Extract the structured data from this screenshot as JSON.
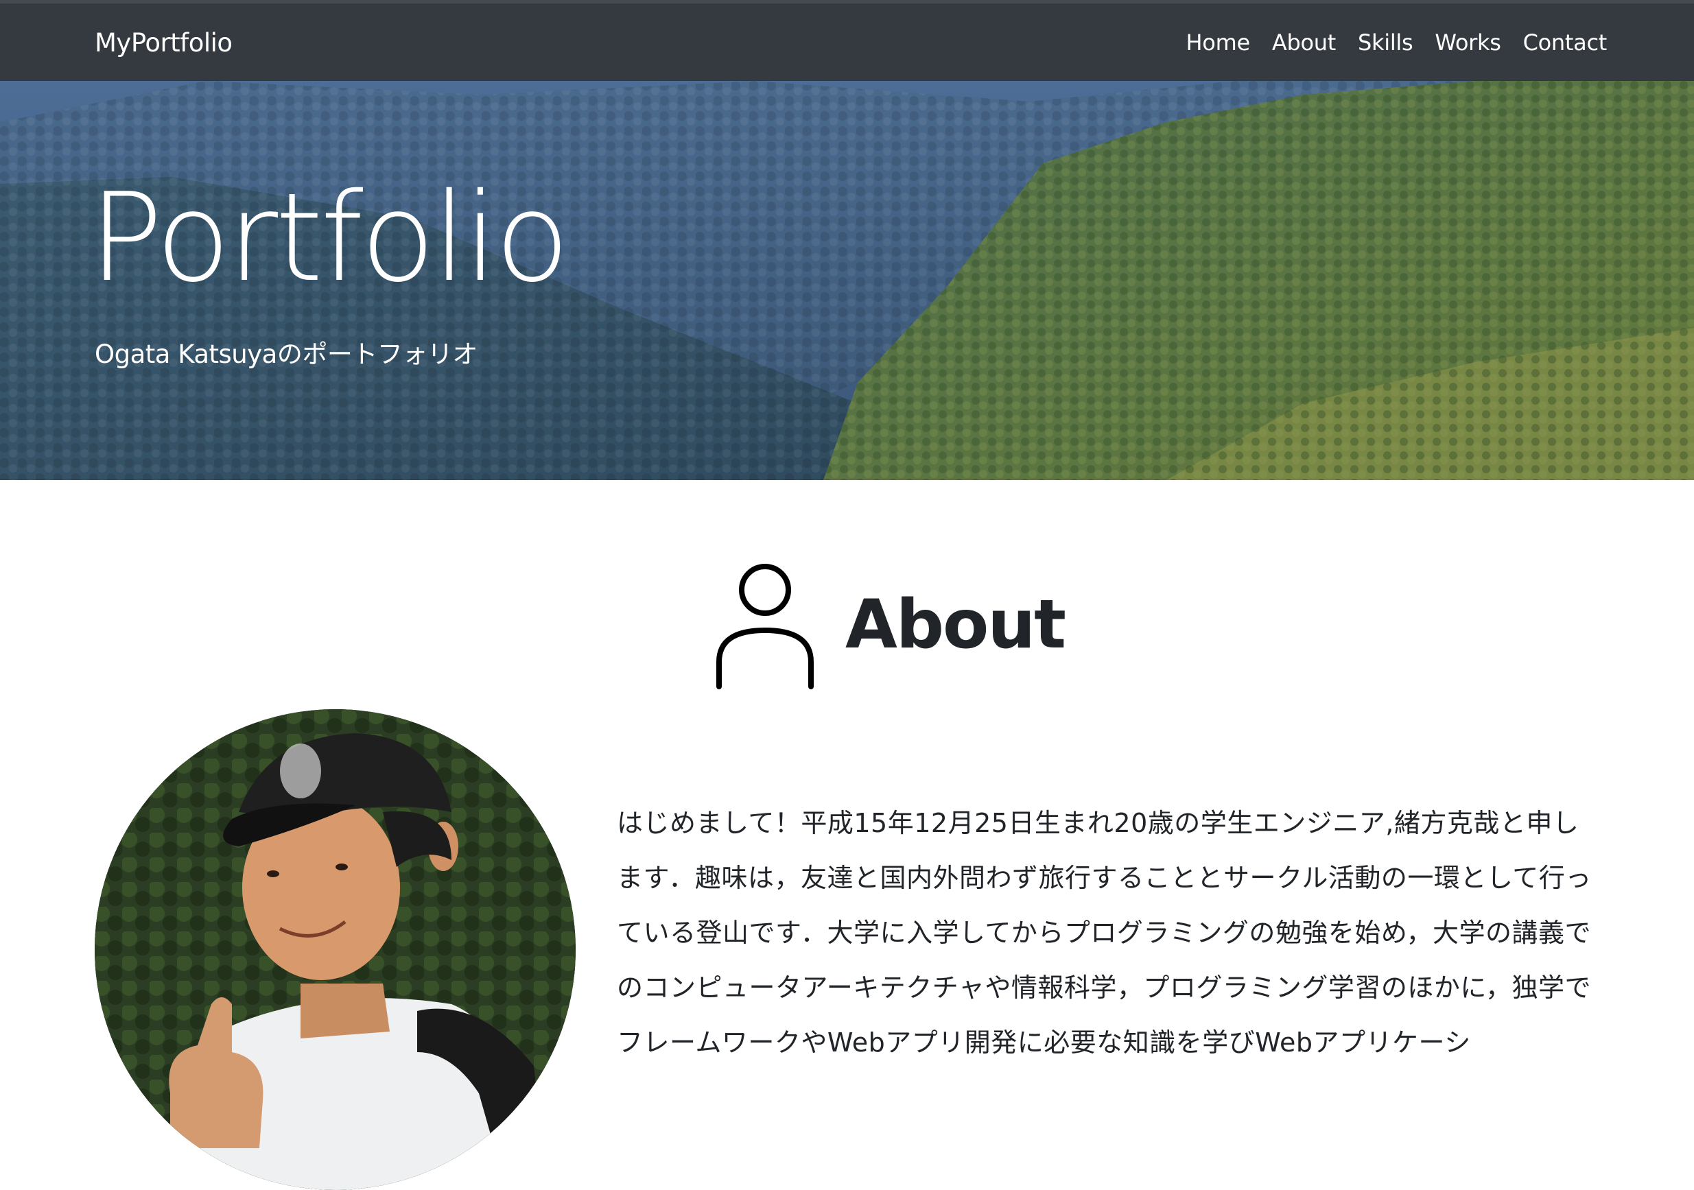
{
  "navbar": {
    "brand": "MyPortfolio",
    "links": [
      "Home",
      "About",
      "Skills",
      "Works",
      "Contact"
    ]
  },
  "hero": {
    "title": "Portfolio",
    "subtitle": "Ogata Katsuyaのポートフォリオ"
  },
  "about": {
    "icon": "person-icon",
    "title": "About",
    "text": "はじめまして！平成15年12月25日生まれ20歳の学生エンジニア,緒方克哉と申します．趣味は，友達と国内外問わず旅行することとサークル活動の一環として行っている登山です．大学に入学してからプログラミングの勉強を始め，大学の講義でのコンピュータアーキテクチャや情報科学，プログラミング学習のほかに，独学でフレームワークやWebアプリ開発に必要な知識を学びWebアプリケーシ"
  },
  "colors": {
    "navbar_bg": "#343a40",
    "text_dark": "#212529"
  }
}
